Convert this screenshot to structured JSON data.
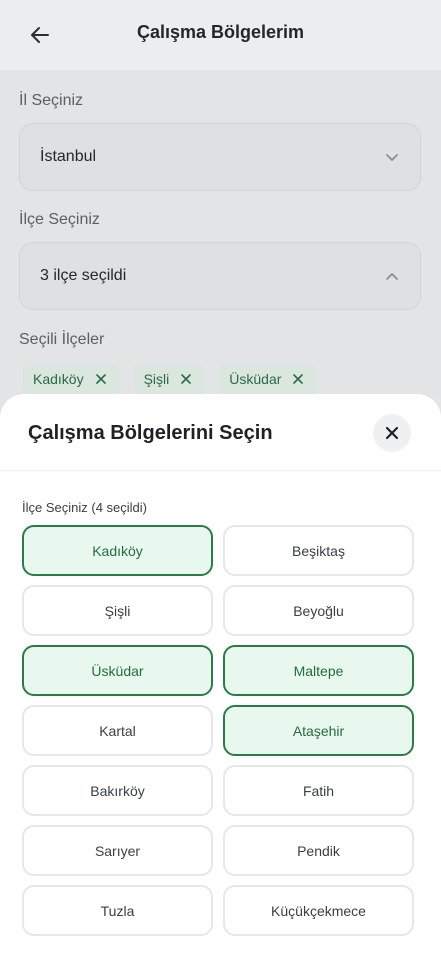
{
  "header": {
    "title": "Çalışma Bölgelerim",
    "back_icon": "arrow-left-icon"
  },
  "province": {
    "label": "İl Seçiniz",
    "value": "İstanbul"
  },
  "district": {
    "label": "İlçe Seçiniz",
    "value": "3 ilçe seçildi"
  },
  "selected_districts": {
    "label": "Seçili İlçeler",
    "chips": [
      "Kadıköy",
      "Şişli",
      "Üsküdar"
    ]
  },
  "sheet": {
    "title": "Çalışma Bölgelerini Seçin",
    "section_label": "İlçe Seçiniz (4 seçildi)",
    "options": [
      {
        "label": "Kadıköy",
        "selected": true
      },
      {
        "label": "Beşiktaş",
        "selected": false
      },
      {
        "label": "Şişli",
        "selected": false
      },
      {
        "label": "Beyoğlu",
        "selected": false
      },
      {
        "label": "Üsküdar",
        "selected": true
      },
      {
        "label": "Maltepe",
        "selected": true
      },
      {
        "label": "Kartal",
        "selected": false
      },
      {
        "label": "Ataşehir",
        "selected": true
      },
      {
        "label": "Bakırköy",
        "selected": false
      },
      {
        "label": "Fatih",
        "selected": false
      },
      {
        "label": "Sarıyer",
        "selected": false
      },
      {
        "label": "Pendik",
        "selected": false
      },
      {
        "label": "Tuzla",
        "selected": false
      },
      {
        "label": "Küçükçekmece",
        "selected": false
      }
    ]
  },
  "colors": {
    "accent": "#2c7a48",
    "selected_bg": "#e9f8ee",
    "chip_bg": "#dbe6df"
  }
}
